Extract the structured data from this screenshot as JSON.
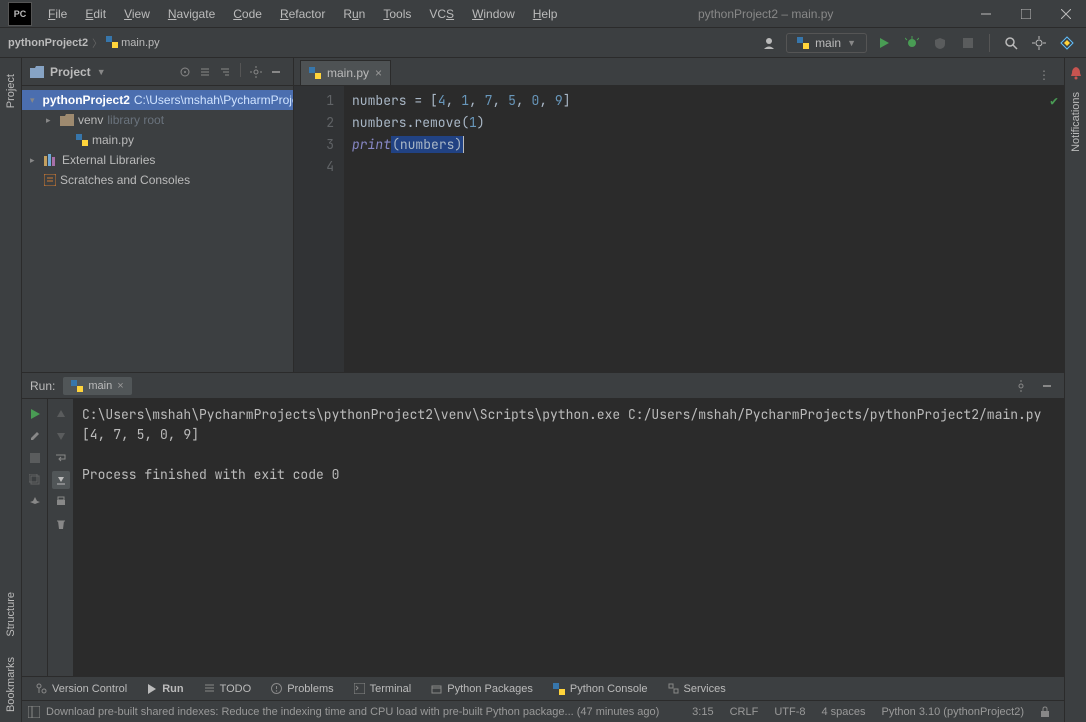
{
  "window": {
    "title": "pythonProject2 – main.py",
    "logo": "PC"
  },
  "menu": [
    "File",
    "Edit",
    "View",
    "Navigate",
    "Code",
    "Refactor",
    "Run",
    "Tools",
    "VCS",
    "Window",
    "Help"
  ],
  "breadcrumbs": [
    "pythonProject2",
    "main.py"
  ],
  "runconfig": {
    "name": "main"
  },
  "project_pane": {
    "title": "Project",
    "root": {
      "name": "pythonProject2",
      "path": "C:\\Users\\mshah\\PycharmProjects\\pythonProject2"
    },
    "venv": {
      "name": "venv",
      "hint": "library root"
    },
    "file": "main.py",
    "external": "External Libraries",
    "scratches": "Scratches and Consoles"
  },
  "editor_tab": "main.py",
  "code": {
    "l1a": "numbers = [",
    "l1nums": [
      "4",
      "1",
      "7",
      "5",
      "0",
      "9"
    ],
    "l1b": "]",
    "l2a": "numbers.remove(",
    "l2num": "1",
    "l2b": ")",
    "l3fn": "print",
    "l3a": "(",
    "l3arg": "numbers",
    "l3b": ")",
    "gutters": [
      "1",
      "2",
      "3",
      "4"
    ]
  },
  "run": {
    "label": "Run:",
    "tab": "main",
    "out1": "C:\\Users\\mshah\\PycharmProjects\\pythonProject2\\venv\\Scripts\\python.exe C:/Users/mshah/PycharmProjects/pythonProject2/main.py",
    "out2": "[4, 7, 5, 0, 9]",
    "out3": "",
    "out4": "Process finished with exit code 0"
  },
  "bottombar": {
    "version_control": "Version Control",
    "run": "Run",
    "todo": "TODO",
    "problems": "Problems",
    "terminal": "Terminal",
    "packages": "Python Packages",
    "console": "Python Console",
    "services": "Services"
  },
  "status": {
    "msg": "Download pre-built shared indexes: Reduce the indexing time and CPU load with pre-built Python package... (47 minutes ago)",
    "pos": "3:15",
    "eol": "CRLF",
    "enc": "UTF-8",
    "indent": "4 spaces",
    "interp": "Python 3.10 (pythonProject2)"
  },
  "sidebar_tabs": {
    "project": "Project",
    "structure": "Structure",
    "bookmarks": "Bookmarks",
    "notifications": "Notifications"
  }
}
